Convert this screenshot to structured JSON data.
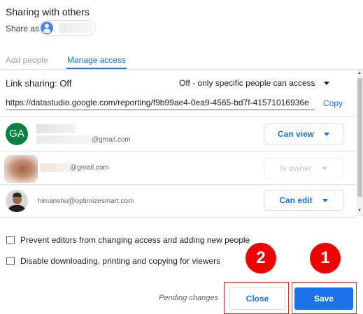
{
  "dialog": {
    "title": "Sharing with others",
    "share_as_label": "Share as"
  },
  "tabs": [
    {
      "label": "Add people",
      "active": false
    },
    {
      "label": "Manage access",
      "active": true
    }
  ],
  "link_sharing": {
    "label": "Link sharing: Off",
    "selected_option": "Off - only specific people can access",
    "url": "https://datastudio.google.com/reporting/f9b99ae4-0ea9-4565-bd7f-41571016936e",
    "copy_label": "Copy"
  },
  "people": [
    {
      "avatar_initials": "GA",
      "email": "@gmail.com",
      "permission": "Can view",
      "permission_enabled": true
    },
    {
      "email": "@gmail.com",
      "permission": "Is owner",
      "permission_enabled": false
    },
    {
      "email": "himanshu@optimizesmart.com",
      "permission": "Can edit",
      "permission_enabled": true
    }
  ],
  "options": [
    {
      "label": "Prevent editors from changing access and adding new people",
      "checked": false
    },
    {
      "label": "Disable downloading, printing and copying for viewers",
      "checked": false
    }
  ],
  "annotations": {
    "close_step": "2",
    "save_step": "1",
    "color": "#ee0000"
  },
  "footer": {
    "pending_text": "Pending changes",
    "close_label": "Close",
    "save_label": "Save"
  },
  "colors": {
    "accent": "#1a73e8",
    "avatar_ga": "#0b8043"
  }
}
